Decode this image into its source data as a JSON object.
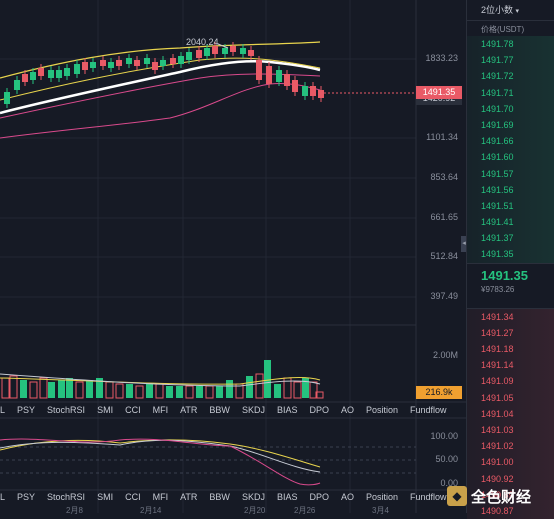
{
  "chart": {
    "annotation_high": "2040.24",
    "price_axis": [
      "1833.23",
      "1101.34",
      "853.64",
      "661.65",
      "512.84",
      "397.49"
    ],
    "current_price_tag": "1491.35",
    "secondary_price_tag": "1420.92",
    "volume_axis": "2.00M",
    "volume_tag": "216.9k",
    "osc_axis": [
      "100.00",
      "50.00",
      "0.00"
    ],
    "indicator_tabs_1": [
      "L",
      "PSY",
      "StochRSI",
      "SMI",
      "CCI",
      "MFI",
      "ATR",
      "BBW",
      "SKDJ",
      "BIAS",
      "DPO",
      "AO",
      "Position",
      "Fundflow"
    ],
    "indicator_tabs_2": [
      "L",
      "PSY",
      "StochRSI",
      "SMI",
      "CCI",
      "MFI",
      "ATR",
      "BBW",
      "SKDJ",
      "BIAS",
      "DPO",
      "AO",
      "Position",
      "Fundflow"
    ],
    "date_labels": [
      "2月8",
      "2月14",
      "2月20",
      "2月26",
      "3月4"
    ],
    "colors": {
      "up": "#25c27f",
      "down": "#e95a66",
      "ma_white": "#ffffff",
      "ma_yellow": "#e8d44d",
      "ma_pink": "#d94a8c",
      "volume_tag_bg": "#f0a030"
    }
  },
  "order_book": {
    "precision_select": "2位小数",
    "column_header": "价格(USDT)",
    "bids": [
      "1491.78",
      "1491.77",
      "1491.72",
      "1491.71",
      "1491.70",
      "1491.69",
      "1491.66",
      "1491.60",
      "1491.57",
      "1491.56",
      "1491.51",
      "1491.41",
      "1491.37",
      "1491.35"
    ],
    "last_price": "1491.35",
    "last_price_cny": "¥9783.26",
    "asks": [
      "1491.34",
      "1491.27",
      "1491.18",
      "1491.14",
      "1491.09",
      "1491.05",
      "1491.04",
      "1491.03",
      "1491.02",
      "1491.00",
      "1490.92",
      "1490.89",
      "1490.87"
    ]
  },
  "watermark": {
    "text": "全色财经"
  }
}
